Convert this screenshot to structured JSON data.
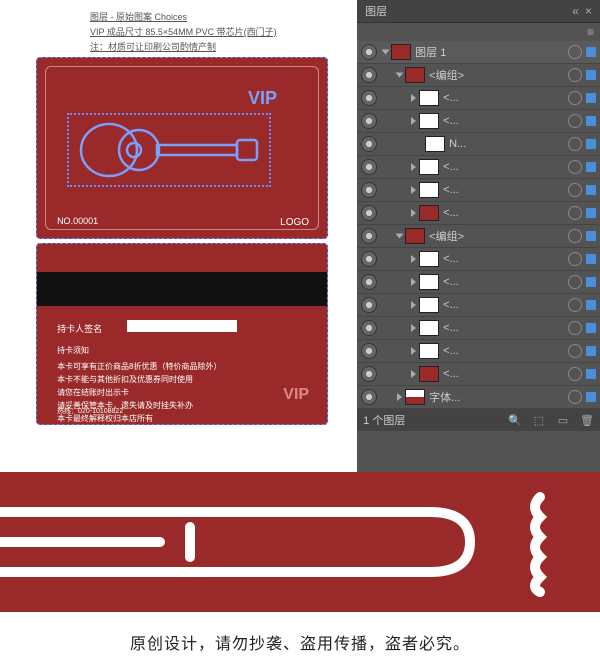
{
  "header": {
    "line1": "图层 - 原始图案   Choices",
    "line2": "VIP 成品尺寸 85.5×54MM PVC 带芯片(西门子)",
    "line3": "注：材质可让印刷公司酌情产制"
  },
  "cardFront": {
    "vip": "VIP",
    "serial": "NO.00001",
    "logo": "LOGO"
  },
  "cardBack": {
    "sigLabel": "持卡人签名",
    "rulesTitle": "持卡须知",
    "rules": [
      "本卡可享有正价商品8折优惠（特价商品除外）",
      "本卡不能与其他折扣及优惠券同时使用",
      "请您在结账时出示卡",
      "请妥善保管本卡，遗失请及时挂失补办",
      "本卡最终解释权归本店所有"
    ],
    "tel": "热线：020-10108822",
    "vip": "VIP"
  },
  "panel": {
    "title": "图层",
    "layers": [
      {
        "depth": 0,
        "arrow": "down",
        "thumb": "master",
        "name": "图层 1",
        "sel": true
      },
      {
        "depth": 1,
        "arrow": "down",
        "thumb": "r",
        "name": "<编组>"
      },
      {
        "depth": 2,
        "arrow": "right",
        "thumb": "w",
        "name": "<..."
      },
      {
        "depth": 2,
        "arrow": "right",
        "thumb": "w",
        "name": "<..."
      },
      {
        "depth": 2,
        "arrow": "",
        "thumb": "w",
        "name": "N..."
      },
      {
        "depth": 2,
        "arrow": "right",
        "thumb": "w",
        "name": "<..."
      },
      {
        "depth": 2,
        "arrow": "right",
        "thumb": "w",
        "name": "<..."
      },
      {
        "depth": 2,
        "arrow": "right",
        "thumb": "r",
        "name": "<..."
      },
      {
        "depth": 1,
        "arrow": "down",
        "thumb": "r",
        "name": "<编组>"
      },
      {
        "depth": 2,
        "arrow": "right",
        "thumb": "w",
        "name": "<..."
      },
      {
        "depth": 2,
        "arrow": "right",
        "thumb": "w",
        "name": "<..."
      },
      {
        "depth": 2,
        "arrow": "right",
        "thumb": "w",
        "name": "<..."
      },
      {
        "depth": 2,
        "arrow": "right",
        "thumb": "w",
        "name": "<..."
      },
      {
        "depth": 2,
        "arrow": "right",
        "thumb": "w",
        "name": "<..."
      },
      {
        "depth": 2,
        "arrow": "right",
        "thumb": "r",
        "name": "<..."
      },
      {
        "depth": 1,
        "arrow": "right",
        "thumb": "font",
        "name": "字体..."
      }
    ],
    "count": "1 个图层"
  },
  "note": "原创设计，请勿抄袭、盗用传播，盗者必究。"
}
